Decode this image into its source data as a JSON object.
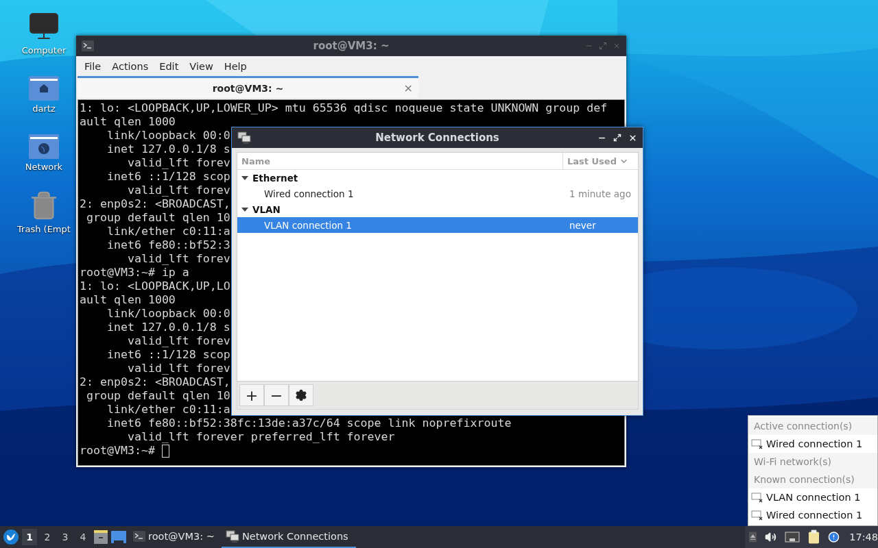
{
  "desktop_icons": [
    {
      "label": "Computer",
      "kind": "computer"
    },
    {
      "label": "dartz",
      "kind": "home"
    },
    {
      "label": "Network",
      "kind": "network"
    },
    {
      "label": "Trash (Empt",
      "kind": "trash"
    }
  ],
  "terminal": {
    "title": "root@VM3: ~",
    "menu": [
      "File",
      "Actions",
      "Edit",
      "View",
      "Help"
    ],
    "tab": {
      "label": "root@VM3: ~",
      "close": "×"
    },
    "lines": [
      "1: lo: <LOOPBACK,UP,LOWER_UP> mtu 65536 qdisc noqueue state UNKNOWN group def",
      "ault qlen 1000",
      "    link/loopback 00:0",
      "    inet 127.0.0.1/8 s",
      "       valid_lft forev",
      "    inet6 ::1/128 scop",
      "       valid_lft forev",
      "2: enp0s2: <BROADCAST,",
      " group default qlen 10",
      "    link/ether c0:11:a",
      "    inet6 fe80::bf52:3",
      "       valid_lft forev",
      "root@VM3:~# ip a",
      "1: lo: <LOOPBACK,UP,LO",
      "ault qlen 1000",
      "    link/loopback 00:0",
      "    inet 127.0.0.1/8 s",
      "       valid_lft forev",
      "    inet6 ::1/128 scop",
      "       valid_lft forev",
      "2: enp0s2: <BROADCAST,",
      " group default qlen 10",
      "    link/ether c0:11:a",
      "    inet6 fe80::bf52:38fc:13de:a37c/64 scope link noprefixroute",
      "       valid_lft forever preferred_lft forever"
    ],
    "prompt": "root@VM3:~# "
  },
  "dialog": {
    "title": "Network Connections",
    "columns": [
      "Name",
      "Last Used"
    ],
    "groups": [
      {
        "label": "Ethernet",
        "expanded": true,
        "children": [
          {
            "name": "Wired connection 1",
            "last_used": "1 minute ago",
            "selected": false
          }
        ]
      },
      {
        "label": "VLAN",
        "expanded": true,
        "children": [
          {
            "name": "VLAN connection 1",
            "last_used": "never",
            "selected": true
          }
        ]
      }
    ],
    "buttons": [
      "+",
      "−"
    ]
  },
  "tray_menu": [
    {
      "kind": "header",
      "label": "Active connection(s)"
    },
    {
      "kind": "item",
      "label": "Wired connection 1"
    },
    {
      "kind": "header",
      "label": "Wi-Fi network(s)"
    },
    {
      "kind": "header",
      "label": "Known connection(s)"
    },
    {
      "kind": "item",
      "label": "VLAN connection 1"
    },
    {
      "kind": "item",
      "label": "Wired connection 1"
    }
  ],
  "taskbar": {
    "workspaces": [
      {
        "label": "1",
        "selected": true
      },
      {
        "label": "2",
        "selected": false
      },
      {
        "label": "3",
        "selected": false
      },
      {
        "label": "4",
        "selected": false
      }
    ],
    "tasks": [
      {
        "label": "root@VM3: ~",
        "kind": "terminal",
        "selected": false
      },
      {
        "label": "Network Connections",
        "kind": "network",
        "selected": true
      }
    ],
    "clock": "17:48"
  }
}
